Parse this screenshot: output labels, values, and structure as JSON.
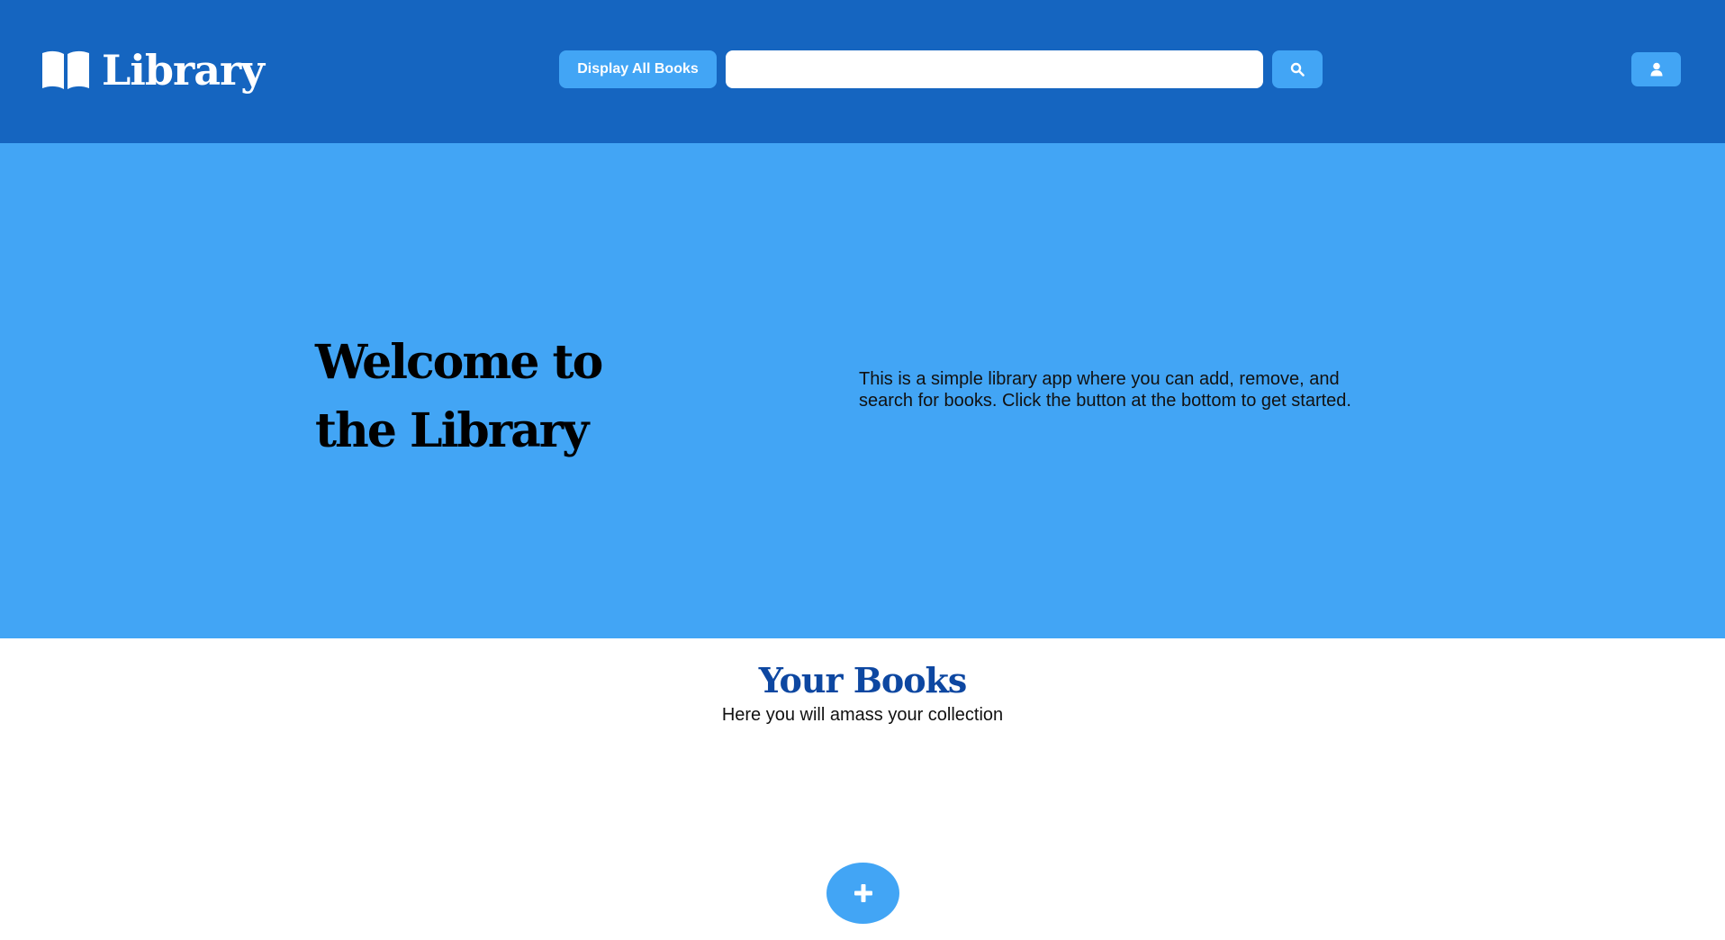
{
  "header": {
    "brand": {
      "icon": "open-book-icon",
      "title": "Library"
    },
    "display_all_label": "Display All Books",
    "search": {
      "value": "",
      "placeholder": "",
      "button_icon": "search-icon"
    },
    "user_button_icon": "user-icon"
  },
  "hero": {
    "title": "Welcome to the Library",
    "description": "This is a simple library app where you can add, remove, and search for books. Click the button at the bottom to get started."
  },
  "books": {
    "title": "Your Books",
    "subtitle": "Here you will amass your collection",
    "add_button_icon": "plus-icon"
  },
  "colors": {
    "header_bg": "#1565c0",
    "accent": "#42a5f5",
    "books_title": "#0d47a1",
    "page_bg": "#ffffff"
  }
}
